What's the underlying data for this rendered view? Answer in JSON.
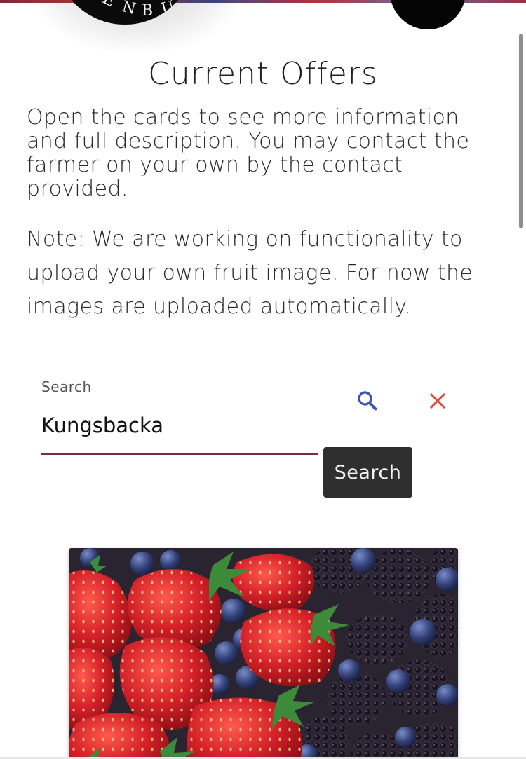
{
  "header": {
    "logo_letters": "ENBU",
    "menu_button": ""
  },
  "offers": {
    "title": "Current Offers",
    "intro": "Open the cards to see more information and full description. You may contact the farmer on your own by the contact provided.",
    "note": "Note: We are working on functionality to upload your own fruit image. For now the images are uploaded automatically."
  },
  "search": {
    "label": "Search",
    "value": "Kungsbacka",
    "button_label": "Search",
    "search_icon": "search-icon",
    "clear_icon": "close-icon"
  },
  "colors": {
    "search_icon": "#3f51b5",
    "clear_icon": "#e0483a",
    "button_bg": "#2f2f2f",
    "underline": "#7a2a4a"
  },
  "cards": [
    {
      "image": "strawberries-blueberries-blackberries"
    }
  ]
}
